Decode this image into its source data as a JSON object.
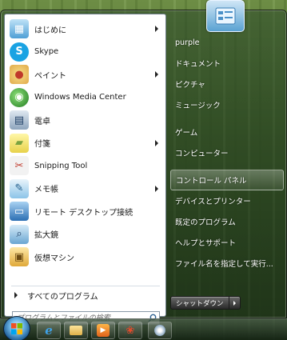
{
  "programs": [
    {
      "label": "はじめに",
      "icon": "getting-started-icon",
      "has_submenu": true
    },
    {
      "label": "Skype",
      "icon": "skype-icon",
      "has_submenu": false
    },
    {
      "label": "ペイント",
      "icon": "paint-icon",
      "has_submenu": true
    },
    {
      "label": "Windows Media Center",
      "icon": "media-center-icon",
      "has_submenu": false
    },
    {
      "label": "電卓",
      "icon": "calculator-icon",
      "has_submenu": false
    },
    {
      "label": "付箋",
      "icon": "sticky-notes-icon",
      "has_submenu": true
    },
    {
      "label": "Snipping Tool",
      "icon": "snipping-tool-icon",
      "has_submenu": false
    },
    {
      "label": "メモ帳",
      "icon": "notepad-icon",
      "has_submenu": true
    },
    {
      "label": "リモート デスクトップ接続",
      "icon": "remote-desktop-icon",
      "has_submenu": false
    },
    {
      "label": "拡大鏡",
      "icon": "magnifier-icon",
      "has_submenu": false
    },
    {
      "label": "仮想マシン",
      "icon": "virtual-machine-icon",
      "has_submenu": false
    }
  ],
  "all_programs_label": "すべてのプログラム",
  "search": {
    "placeholder": "プログラムとファイルの検索"
  },
  "right_items": [
    {
      "label": "purple"
    },
    {
      "label": "ドキュメント"
    },
    {
      "label": "ピクチャ"
    },
    {
      "label": "ミュージック"
    },
    {
      "label": "ゲーム"
    },
    {
      "label": "コンピューター"
    },
    {
      "label": "コントロール パネル"
    },
    {
      "label": "デバイスとプリンター"
    },
    {
      "label": "既定のプログラム"
    },
    {
      "label": "ヘルプとサポート"
    },
    {
      "label": "ファイル名を指定して実行..."
    }
  ],
  "shutdown_label": "シャットダウン",
  "colors": {
    "accent": "#1b5a92",
    "pane_bg": "#ffffff"
  }
}
